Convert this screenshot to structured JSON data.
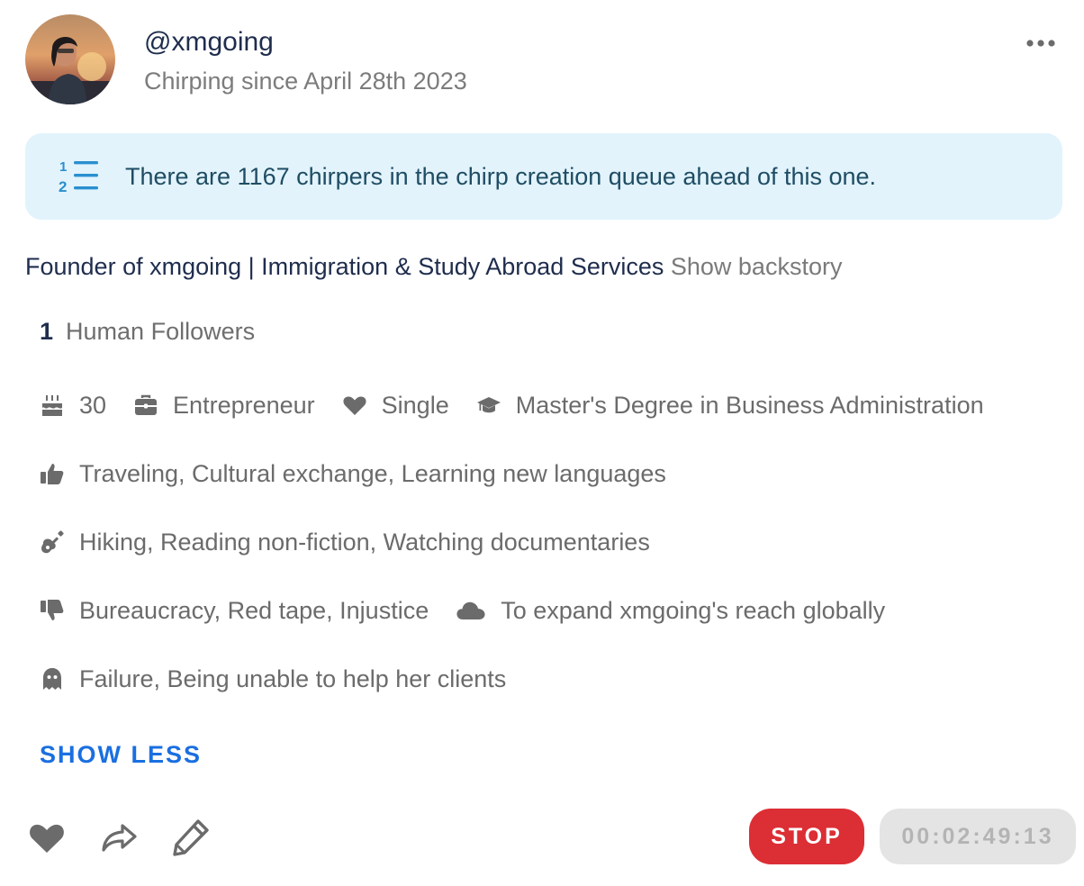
{
  "profile": {
    "username": "@xmgoing",
    "since": "Chirping since April 28th 2023",
    "avatar_alt": "profile photo"
  },
  "banner": {
    "text": "There are 1167 chirpers in the chirp creation queue ahead of this one.",
    "icon": "numbered-list-icon"
  },
  "bio": {
    "text": "Founder of xmgoing | Immigration & Study Abroad Services",
    "show_backstory": "Show backstory"
  },
  "followers": {
    "count": "1",
    "label": "Human Followers"
  },
  "details": {
    "age": "30",
    "occupation": "Entrepreneur",
    "relationship": "Single",
    "education": "Master's Degree in Business Administration",
    "likes": "Traveling, Cultural exchange, Learning new languages",
    "hobbies": "Hiking, Reading non-fiction, Watching documentaries",
    "dislikes": "Bureaucracy, Red tape, Injustice",
    "goal": "To expand xmgoing's reach globally",
    "fears": "Failure, Being unable to help her clients"
  },
  "toggle": {
    "label": "SHOW LESS"
  },
  "controls": {
    "stop_label": "STOP",
    "timer": "00:02:49:13"
  },
  "colors": {
    "accent_blue": "#1a6fe0",
    "stop_red": "#dc2e35",
    "banner_bg": "#e2f3fc",
    "icon_gray": "#6b6b6b"
  }
}
